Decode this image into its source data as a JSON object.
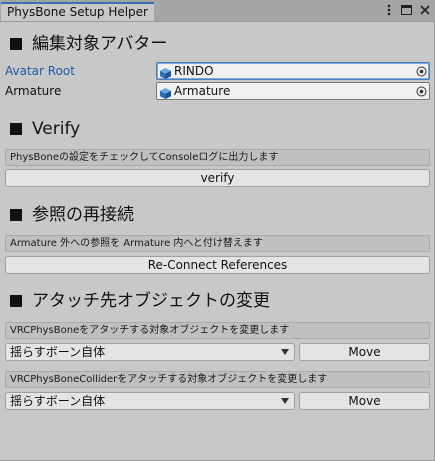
{
  "window": {
    "tab_title": "PhysBone Setup Helper"
  },
  "sections": {
    "avatar": {
      "heading": "編集対象アバター"
    },
    "verify": {
      "heading": "Verify",
      "help": "PhysBoneの設定をチェックしてConsoleログに出力します",
      "button": "verify"
    },
    "reconnect": {
      "heading": "参照の再接続",
      "help": "Armature 外への参照を Armature 内へと付け替えます",
      "button": "Re-Connect References"
    },
    "attach": {
      "heading": "アタッチ先オブジェクトの変更",
      "physbone_help": "VRCPhysBoneをアタッチする対象オブジェクトを変更します",
      "physbone_select": "揺らすボーン自体",
      "physbone_button": "Move",
      "collider_help": "VRCPhysBoneColliderをアタッチする対象オブジェクトを変更します",
      "collider_select": "揺らすボーン自体",
      "collider_button": "Move"
    }
  },
  "fields": {
    "avatar_root": {
      "label": "Avatar Root",
      "value": "RINDO"
    },
    "armature": {
      "label": "Armature",
      "value": "Armature"
    }
  },
  "icons": {
    "tab_menu": "kebab-menu-icon",
    "tab_maximize": "maximize-icon",
    "tab_close": "close-icon",
    "object": "gameobject-cube-icon",
    "picker": "object-picker-icon"
  },
  "colors": {
    "tab_accent": "#3a72b0",
    "avatar_root_label": "#1f5aa8",
    "panel_bg": "#c8c8c8"
  }
}
